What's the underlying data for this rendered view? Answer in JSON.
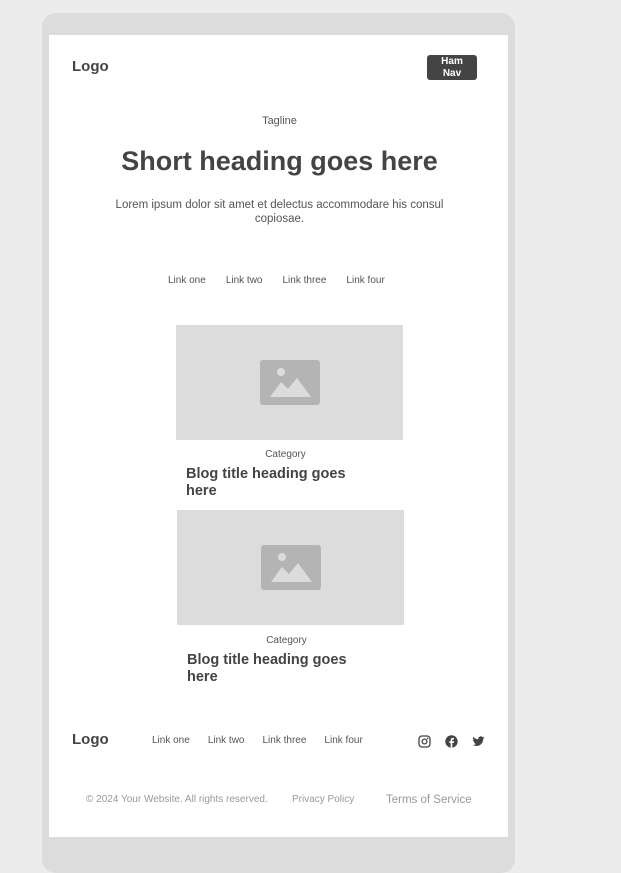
{
  "header": {
    "logo": "Logo",
    "menu_button": "Ham\nNav"
  },
  "hero": {
    "tagline": "Tagline",
    "title": "Short heading goes here",
    "description": "Lorem ipsum dolor sit amet et delectus accommodare his consul copiosae."
  },
  "nav_links": [
    "Link one",
    "Link two",
    "Link three",
    "Link four"
  ],
  "blog_posts": [
    {
      "category": "Category",
      "title": "Blog title heading goes here",
      "image_icon": "image-placeholder-icon"
    },
    {
      "category": "Category",
      "title": "Blog title heading goes here",
      "image_icon": "image-placeholder-icon"
    }
  ],
  "footer": {
    "logo": "Logo",
    "links": [
      "Link one",
      "Link two",
      "Link three",
      "Link four"
    ],
    "social_icons": [
      "instagram-icon",
      "facebook-icon",
      "twitter-icon"
    ],
    "copyright": "© 2024 Your Website. All rights reserved.",
    "privacy": "Privacy Policy",
    "terms": "Terms of Service"
  },
  "colors": {
    "dark": "#444444",
    "placeholder": "#dcdcdc",
    "icon_gray": "#b4b4b4",
    "page_bg": "#ececec"
  }
}
